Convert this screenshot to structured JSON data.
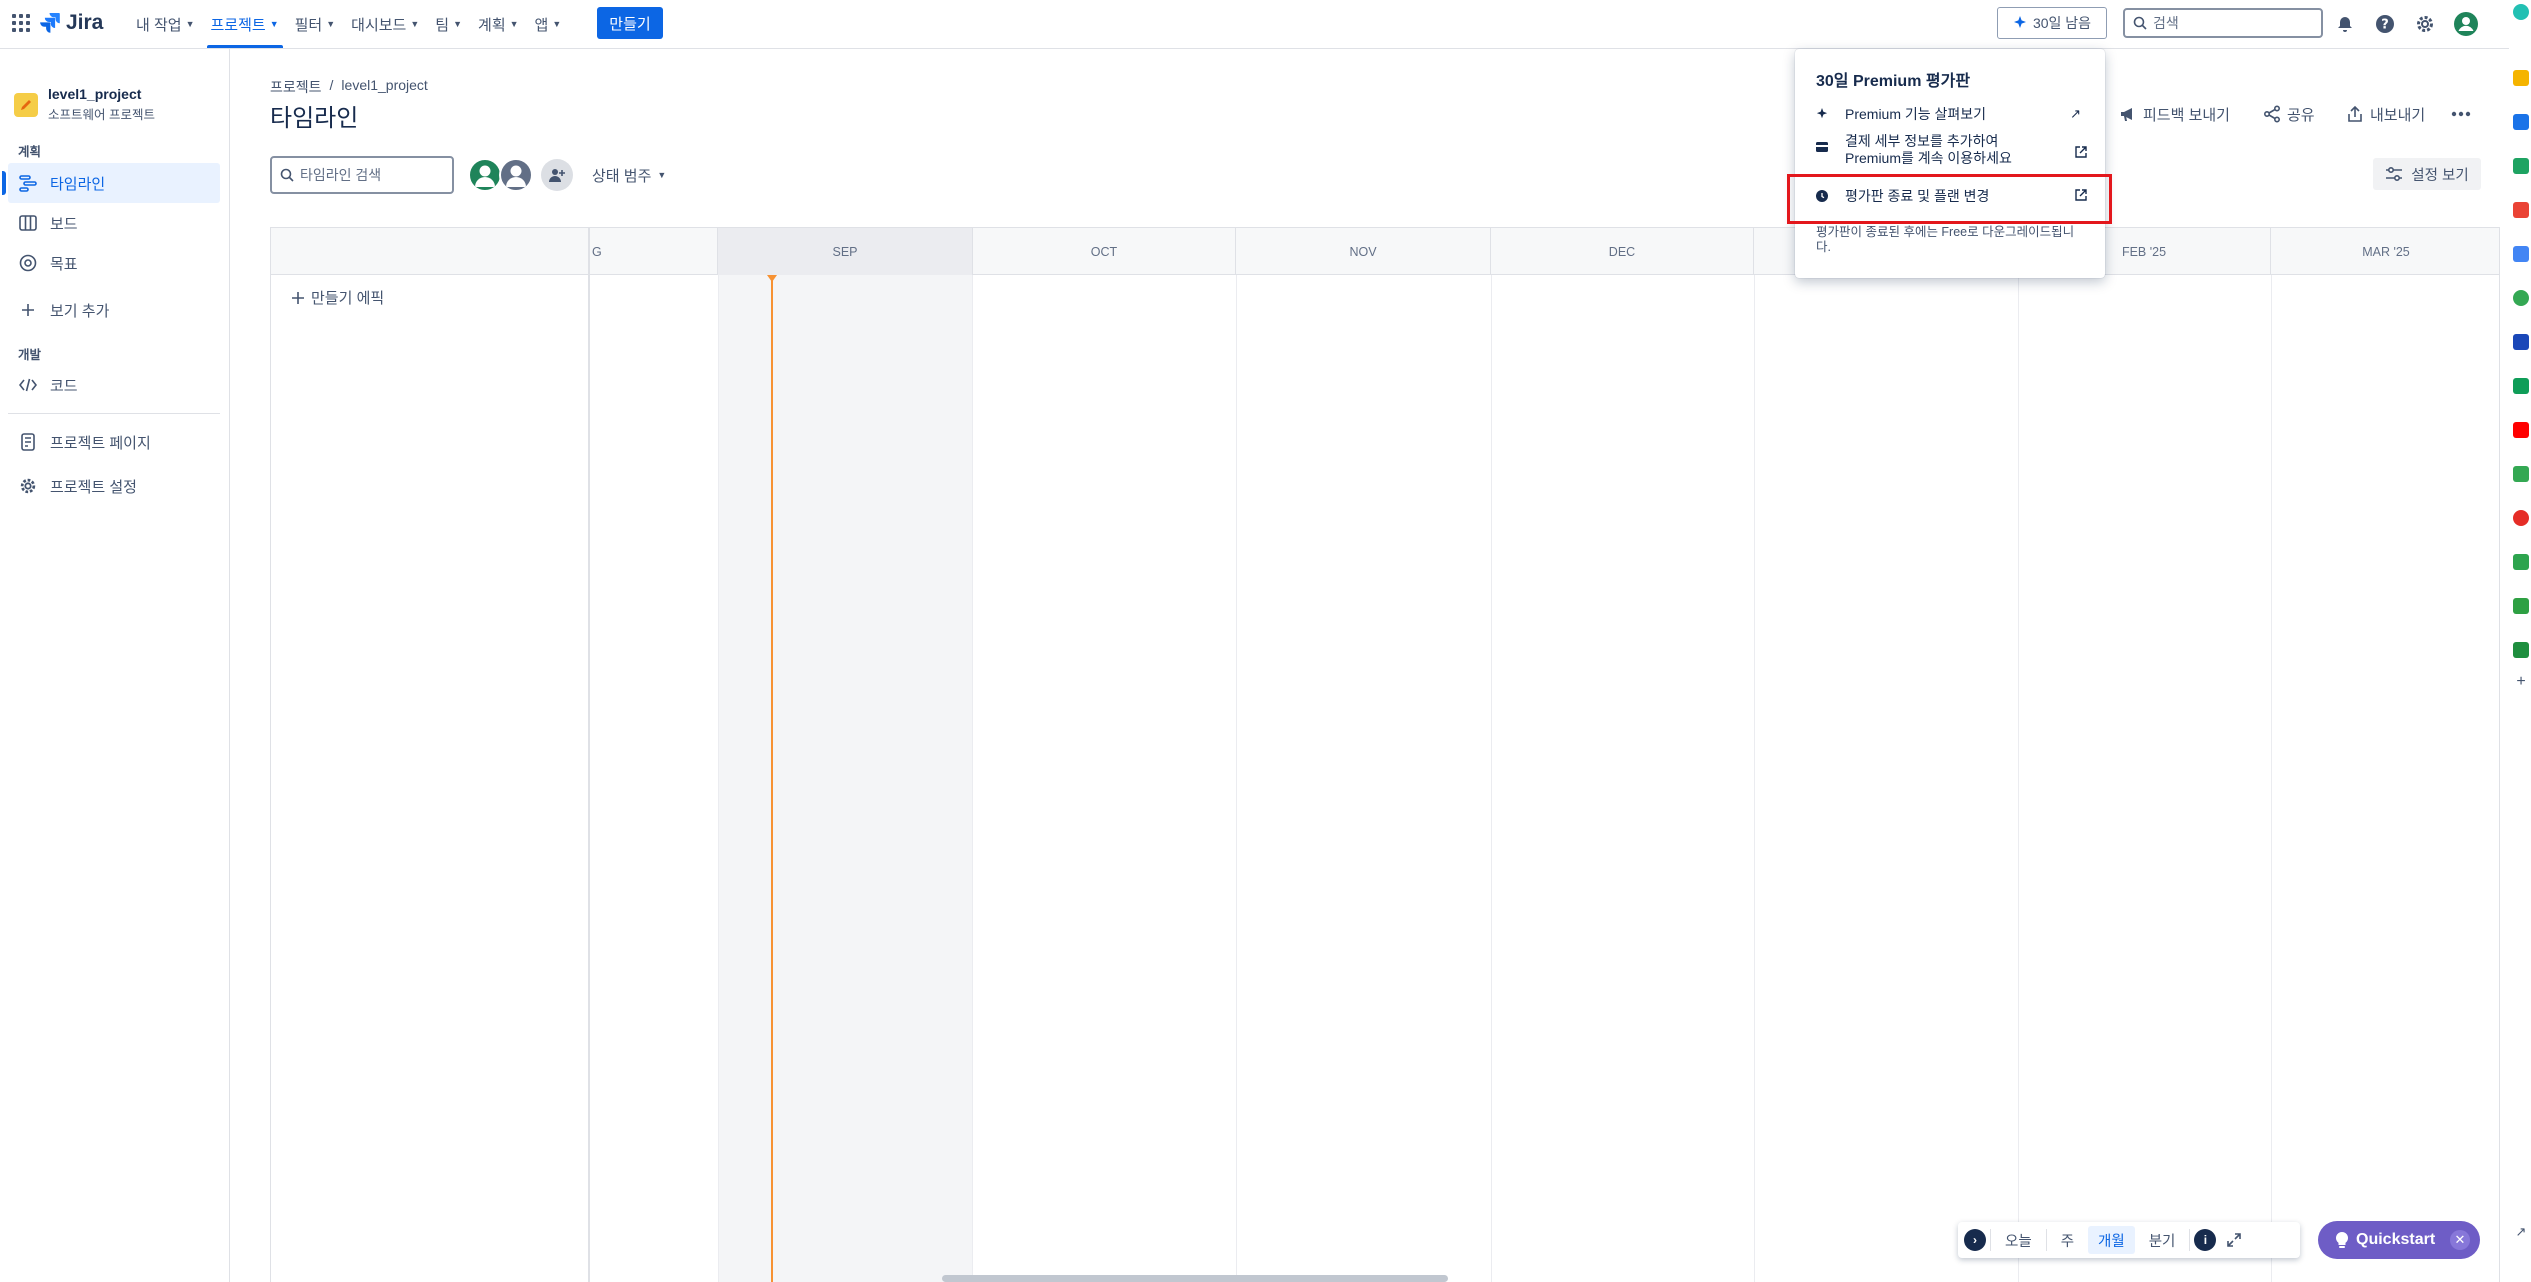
{
  "app": {
    "name": "Jira"
  },
  "topnav": {
    "items": [
      {
        "label": "내 작업"
      },
      {
        "label": "프로젝트"
      },
      {
        "label": "필터"
      },
      {
        "label": "대시보드"
      },
      {
        "label": "팀"
      },
      {
        "label": "계획"
      },
      {
        "label": "앱"
      }
    ],
    "create_label": "만들기",
    "trial_label": "30일 남음",
    "search_placeholder": "검색"
  },
  "sidebar": {
    "project_name": "level1_project",
    "project_type": "소프트웨어 프로젝트",
    "section_plan": "계획",
    "section_dev": "개발",
    "items": [
      {
        "label": "타임라인"
      },
      {
        "label": "보드"
      },
      {
        "label": "목표"
      },
      {
        "label": "보기 추가"
      },
      {
        "label": "코드"
      },
      {
        "label": "프로젝트 페이지"
      },
      {
        "label": "프로젝트 설정"
      }
    ]
  },
  "main": {
    "breadcrumb": [
      "프로젝트",
      "/",
      "level1_project"
    ],
    "title": "타임라인",
    "search_placeholder": "타임라인 검색",
    "status_filter": "상태 범주",
    "actions": {
      "feedback": "피드백 보내기",
      "share": "공유",
      "export": "내보내기"
    },
    "view_settings": "설정 보기"
  },
  "timeline": {
    "months": [
      "G",
      "SEP",
      "OCT",
      "NOV",
      "DEC",
      "",
      "FEB '25",
      "MAR '25"
    ],
    "create_epic": "만들기 에픽"
  },
  "zoom": {
    "today": "오늘",
    "week": "주",
    "month": "개월",
    "quarter": "분기",
    "selected": "개월"
  },
  "quickstart": {
    "label": "Quickstart"
  },
  "popup": {
    "title": "30일 Premium 평가판",
    "items": [
      {
        "label": "Premium 기능 살펴보기"
      },
      {
        "label_line1": "결제 세부 정보를 추가하여",
        "label_line2": "Premium를 계속 이용하세요"
      },
      {
        "label": "평가판 종료 및 플랜 변경"
      }
    ],
    "note": "평가판이 종료된 후에는 Free로 다운그레이드됩니다."
  },
  "colors": {
    "brand": "#0c66e4",
    "today_marker": "#f79233",
    "quickstart": "#6e5dc6",
    "highlight": "#e3171c"
  }
}
